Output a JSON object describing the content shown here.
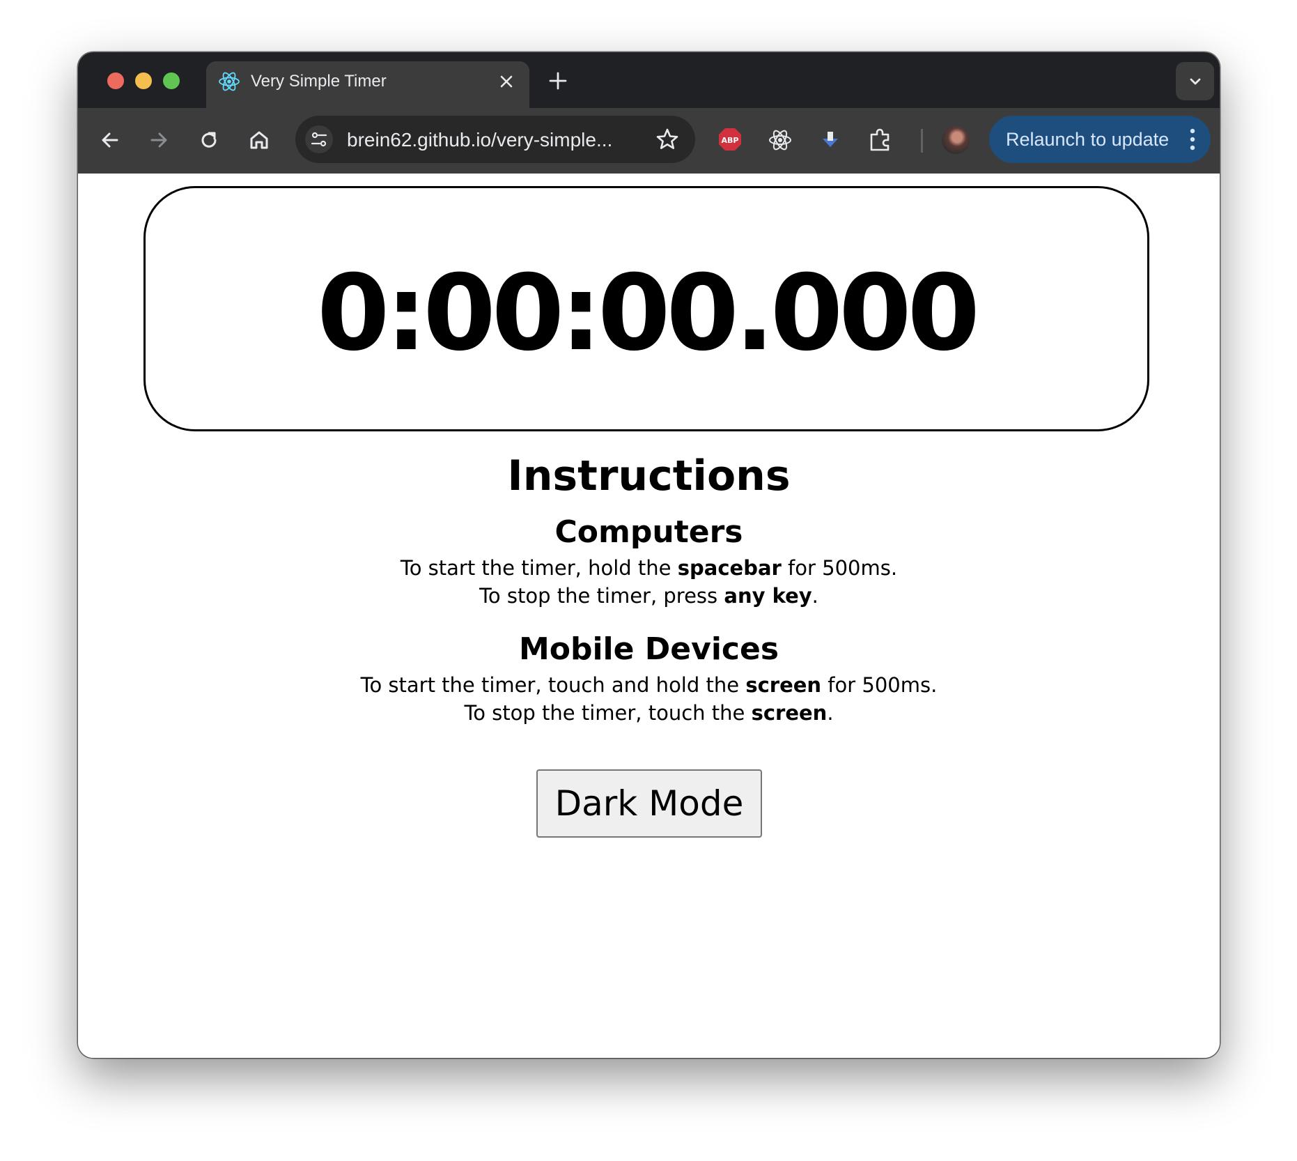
{
  "browser": {
    "tab": {
      "title": "Very Simple Timer",
      "favicon": "react-atom-icon"
    },
    "url": "brein62.github.io/very-simple...",
    "extensions": [
      "abp-icon",
      "react-devtools-icon",
      "download-icon",
      "puzzle-extensions-icon"
    ],
    "extension_abp_label": "ABP",
    "relaunch_label": "Relaunch to update",
    "colors": {
      "tabstrip": "#202124",
      "toolbar": "#3c3c3c",
      "relaunch": "#1e4e7e",
      "abp_red": "#d2303c"
    }
  },
  "page": {
    "timer": "0:00:00.000",
    "instructions_heading": "Instructions",
    "computers": {
      "heading": "Computers",
      "line1": {
        "before": "To start the timer, hold the ",
        "bold": "spacebar",
        "after": " for 500ms."
      },
      "line2": {
        "before": "To stop the timer, press ",
        "bold": "any key",
        "after": "."
      }
    },
    "mobile": {
      "heading": "Mobile Devices",
      "line1": {
        "before": "To start the timer, touch and hold the ",
        "bold": "screen",
        "after": " for 500ms."
      },
      "line2": {
        "before": "To stop the timer, touch the ",
        "bold": "screen",
        "after": "."
      }
    },
    "dark_mode_label": "Dark Mode"
  }
}
